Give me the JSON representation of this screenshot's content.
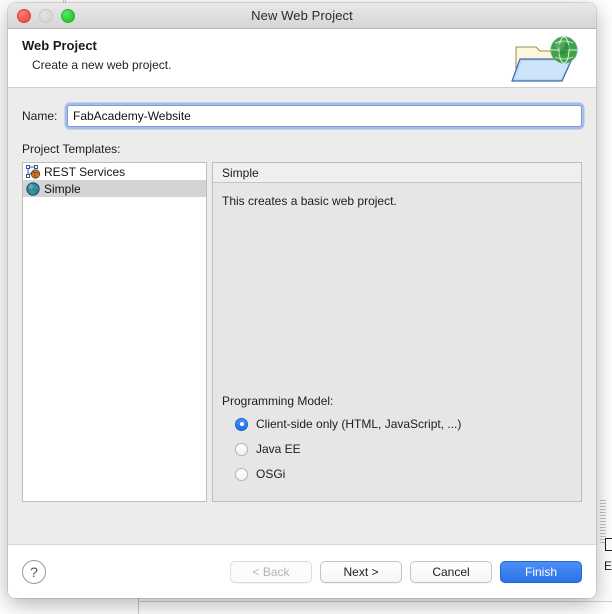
{
  "window": {
    "title": "New Web Project",
    "traffic_lights": [
      "close-button",
      "minimize-button",
      "maximize-button"
    ]
  },
  "header": {
    "title": "Web Project",
    "subtitle": "Create a new web project.",
    "icon": "web-folder-globe-icon"
  },
  "form": {
    "name_label": "Name:",
    "name_value": "FabAcademy-Website",
    "name_placeholder": "",
    "templates_label": "Project Templates:"
  },
  "templates": {
    "items": [
      {
        "label": "REST Services",
        "icon": "rest-services-icon",
        "selected": false
      },
      {
        "label": "Simple",
        "icon": "globe-icon",
        "selected": true
      }
    ]
  },
  "detail": {
    "header": "Simple",
    "description": "This creates a basic web project.",
    "programming_model_label": "Programming Model:",
    "options": [
      {
        "label": "Client-side only (HTML, JavaScript, ...)",
        "selected": true
      },
      {
        "label": "Java EE",
        "selected": false
      },
      {
        "label": "OSGi",
        "selected": false
      }
    ]
  },
  "footer": {
    "help_label": "?",
    "back_label": "< Back",
    "next_label": "Next >",
    "cancel_label": "Cancel",
    "finish_label": "Finish"
  },
  "background": {
    "partial_letter": "E"
  },
  "colors": {
    "accent": "#2a72e8",
    "selection": "#d4d4d4",
    "focus_ring": "#6e96e6",
    "dialog_bg": "#ececec"
  }
}
